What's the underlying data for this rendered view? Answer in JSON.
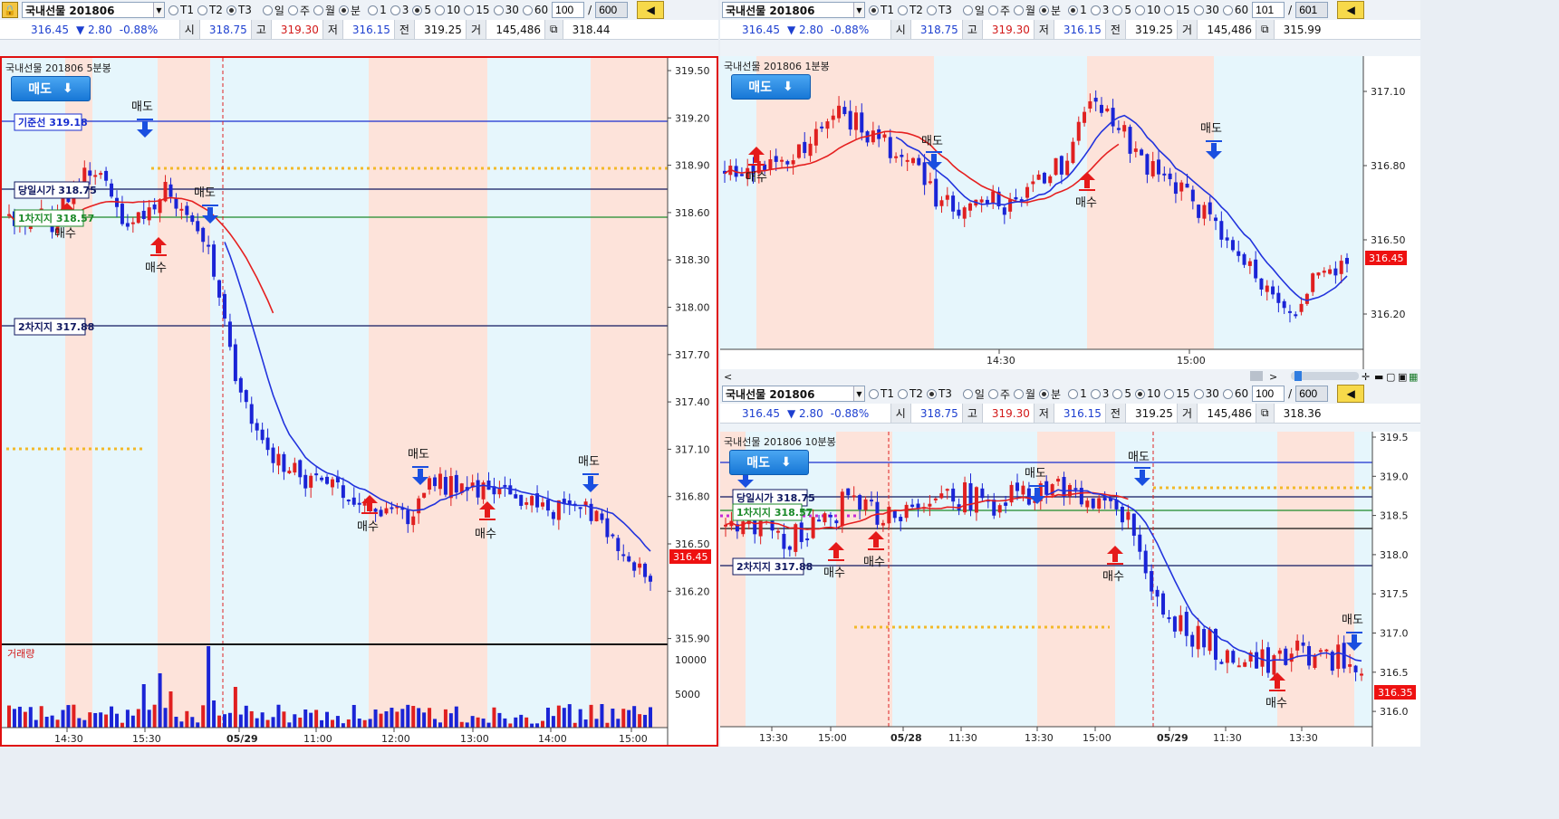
{
  "left_panel": {
    "toolbar": {
      "product": "국내선물 201806",
      "tick_options": [
        "T1",
        "T2",
        "T3"
      ],
      "tick_selected": "T3",
      "period_options": [
        "일",
        "주",
        "월",
        "분"
      ],
      "period_selected": "분",
      "interval_options": [
        "1",
        "3",
        "5",
        "10",
        "15",
        "30",
        "60"
      ],
      "interval_selected": "5",
      "count": "100",
      "total": "600",
      "slash": "/"
    },
    "quote": {
      "price": "316.45",
      "change": "▼ 2.80",
      "pct": "-0.88%",
      "open_label": "시",
      "open": "318.75",
      "high_label": "고",
      "high": "319.30",
      "low_label": "저",
      "low": "316.15",
      "prev_label": "전",
      "prev": "319.25",
      "vol_label": "거",
      "volume": "145,486",
      "extra": "318.44"
    },
    "chart_title": "국내선물 201806   5분봉",
    "sell_button": "매도",
    "volume_label": "거래량",
    "price_tag": "316.45",
    "level_labels": [
      {
        "name": "기준선",
        "value": "319.18",
        "color": "#1a2fd0"
      },
      {
        "name": "당일시가",
        "value": "318.75",
        "color": "#101860"
      },
      {
        "name": "1차지지",
        "value": "318.57",
        "color": "#1c8a2a"
      },
      {
        "name": "2차지지",
        "value": "317.88",
        "color": "#101860"
      }
    ],
    "signals": [
      {
        "type": "매도",
        "at": 0
      },
      {
        "type": "매수",
        "at": 1
      },
      {
        "type": "매수",
        "at": 2
      },
      {
        "type": "매도",
        "at": 3
      },
      {
        "type": "매수",
        "at": 4
      },
      {
        "type": "매도",
        "at": 5
      },
      {
        "type": "매수",
        "at": 6
      },
      {
        "type": "매도",
        "at": 7
      }
    ],
    "y_ticks": [
      "319.50",
      "319.20",
      "318.90",
      "318.60",
      "318.30",
      "318.00",
      "317.70",
      "317.40",
      "317.10",
      "316.80",
      "316.50",
      "316.20",
      "315.90"
    ],
    "volume_ticks": [
      "10000",
      "5000"
    ],
    "x_ticks": [
      "14:30",
      "15:30",
      "05/29",
      "11:00",
      "12:00",
      "13:00",
      "14:00",
      "15:00"
    ]
  },
  "right_top_panel": {
    "toolbar": {
      "product": "국내선물 201806",
      "tick_options": [
        "T1",
        "T2",
        "T3"
      ],
      "tick_selected": "T1",
      "period_options": [
        "일",
        "주",
        "월",
        "분"
      ],
      "period_selected": "분",
      "interval_options": [
        "1",
        "3",
        "5",
        "10",
        "15",
        "30",
        "60"
      ],
      "interval_selected": "1",
      "count": "101",
      "total": "601",
      "slash": "/"
    },
    "quote": {
      "price": "316.45",
      "change": "▼ 2.80",
      "pct": "-0.88%",
      "open_label": "시",
      "open": "318.75",
      "high_label": "고",
      "high": "319.30",
      "low_label": "저",
      "low": "316.15",
      "prev_label": "전",
      "prev": "319.25",
      "vol_label": "거",
      "volume": "145,486",
      "extra": "315.99"
    },
    "chart_title": "국내선물 201806   1분봉",
    "sell_button": "매도",
    "price_tag": "316.45",
    "signals": [
      {
        "type": "매수"
      },
      {
        "type": "매도"
      },
      {
        "type": "매수"
      },
      {
        "type": "매도"
      }
    ],
    "y_ticks": [
      "317.10",
      "316.80",
      "316.50",
      "316.20"
    ],
    "x_ticks": [
      "14:30",
      "15:00"
    ]
  },
  "right_bottom_panel": {
    "scroll_left": "<",
    "scroll_right": ">",
    "toolbar": {
      "product": "국내선물 201806",
      "tick_options": [
        "T1",
        "T2",
        "T3"
      ],
      "tick_selected": "T3",
      "period_options": [
        "일",
        "주",
        "월",
        "분"
      ],
      "period_selected": "분",
      "interval_options": [
        "1",
        "3",
        "5",
        "10",
        "15",
        "30",
        "60"
      ],
      "interval_selected": "10",
      "count": "100",
      "total": "600",
      "slash": "/"
    },
    "quote": {
      "price": "316.45",
      "change": "▼ 2.80",
      "pct": "-0.88%",
      "open_label": "시",
      "open": "318.75",
      "high_label": "고",
      "high": "319.30",
      "low_label": "저",
      "low": "316.15",
      "prev_label": "전",
      "prev": "319.25",
      "vol_label": "거",
      "volume": "145,486",
      "extra": "318.36"
    },
    "chart_title": "국내선물 201806   10분봉",
    "sell_button": "매도",
    "price_tag": "316.35",
    "level_labels": [
      {
        "name": "당일시가",
        "value": "318.75",
        "color": "#101860"
      },
      {
        "name": "1차지지",
        "value": "318.57",
        "color": "#1c8a2a"
      },
      {
        "name": "2차지지",
        "value": "317.88",
        "color": "#101860"
      }
    ],
    "signals": [
      {
        "type": "매도"
      },
      {
        "type": "매수"
      },
      {
        "type": "매수"
      },
      {
        "type": "매도"
      },
      {
        "type": "매수"
      },
      {
        "type": "매도"
      },
      {
        "type": "매도"
      },
      {
        "type": "매수"
      }
    ],
    "y_ticks": [
      "319.5",
      "319.0",
      "318.5",
      "318.0",
      "317.5",
      "317.0",
      "316.5",
      "316.0"
    ],
    "x_ticks": [
      "13:30",
      "15:00",
      "05/28",
      "11:30",
      "13:30",
      "15:00",
      "05/29",
      "11:30",
      "13:30"
    ]
  },
  "colors": {
    "up": "#e02020",
    "down": "#1a24d6",
    "ma": "#2233dd",
    "ma2": "#e52020",
    "pink": "#fde3da",
    "sky": "#e6f6fc",
    "active_border": "#e01010"
  }
}
